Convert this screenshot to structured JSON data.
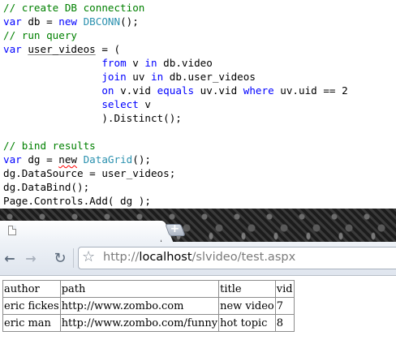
{
  "code": {
    "lines": [
      [
        [
          "cm",
          "// create DB connection"
        ]
      ],
      [
        [
          "kw",
          "var"
        ],
        [
          "tx",
          " db = "
        ],
        [
          "kw",
          "new"
        ],
        [
          "tx",
          " "
        ],
        [
          "ty",
          "DBCONN"
        ],
        [
          "tx",
          "();"
        ]
      ],
      [
        [
          "cm",
          "// run query"
        ]
      ],
      [
        [
          "kw",
          "var"
        ],
        [
          "tx",
          " "
        ],
        [
          "ul",
          "user_videos"
        ],
        [
          "tx",
          " = ("
        ]
      ],
      [
        [
          "tx",
          "                "
        ],
        [
          "kw",
          "from"
        ],
        [
          "tx",
          " v "
        ],
        [
          "kw",
          "in"
        ],
        [
          "tx",
          " db.video"
        ]
      ],
      [
        [
          "tx",
          "                "
        ],
        [
          "kw",
          "join"
        ],
        [
          "tx",
          " uv "
        ],
        [
          "kw",
          "in"
        ],
        [
          "tx",
          " db.user_videos"
        ]
      ],
      [
        [
          "tx",
          "                "
        ],
        [
          "kw",
          "on"
        ],
        [
          "tx",
          " v.vid "
        ],
        [
          "kw",
          "equals"
        ],
        [
          "tx",
          " uv.vid "
        ],
        [
          "kw",
          "where"
        ],
        [
          "tx",
          " uv.uid == 2"
        ]
      ],
      [
        [
          "tx",
          "                "
        ],
        [
          "kw",
          "select"
        ],
        [
          "tx",
          " v"
        ]
      ],
      [
        [
          "tx",
          "                ).Distinct();"
        ]
      ],
      [
        [
          "tx",
          ""
        ]
      ],
      [
        [
          "cm",
          "// bind results"
        ]
      ],
      [
        [
          "kw",
          "var"
        ],
        [
          "tx",
          " dg = "
        ],
        [
          "squig",
          "new"
        ],
        [
          "tx",
          " "
        ],
        [
          "ty",
          "DataGrid"
        ],
        [
          "tx",
          "();"
        ]
      ],
      [
        [
          "tx",
          "dg.DataSource = user_videos;"
        ]
      ],
      [
        [
          "tx",
          "dg.DataBind();"
        ]
      ],
      [
        [
          "tx",
          "Page.Controls.Add( dg );"
        ]
      ]
    ]
  },
  "browser": {
    "new_tab_label": "+",
    "back_glyph": "←",
    "forward_glyph": "→",
    "reload_glyph": "↻",
    "star_glyph": "☆",
    "url_scheme": "http://",
    "url_host": "localhost",
    "url_rest": "/slvideo/test.aspx"
  },
  "grid": {
    "header": [
      "author",
      "path",
      "title",
      "vid"
    ],
    "rows": [
      [
        "eric fickes",
        "http://www.zombo.com",
        "new video",
        "7"
      ],
      [
        "eric man",
        "http://www.zombo.com/funny",
        "hot topic",
        "8"
      ]
    ]
  }
}
